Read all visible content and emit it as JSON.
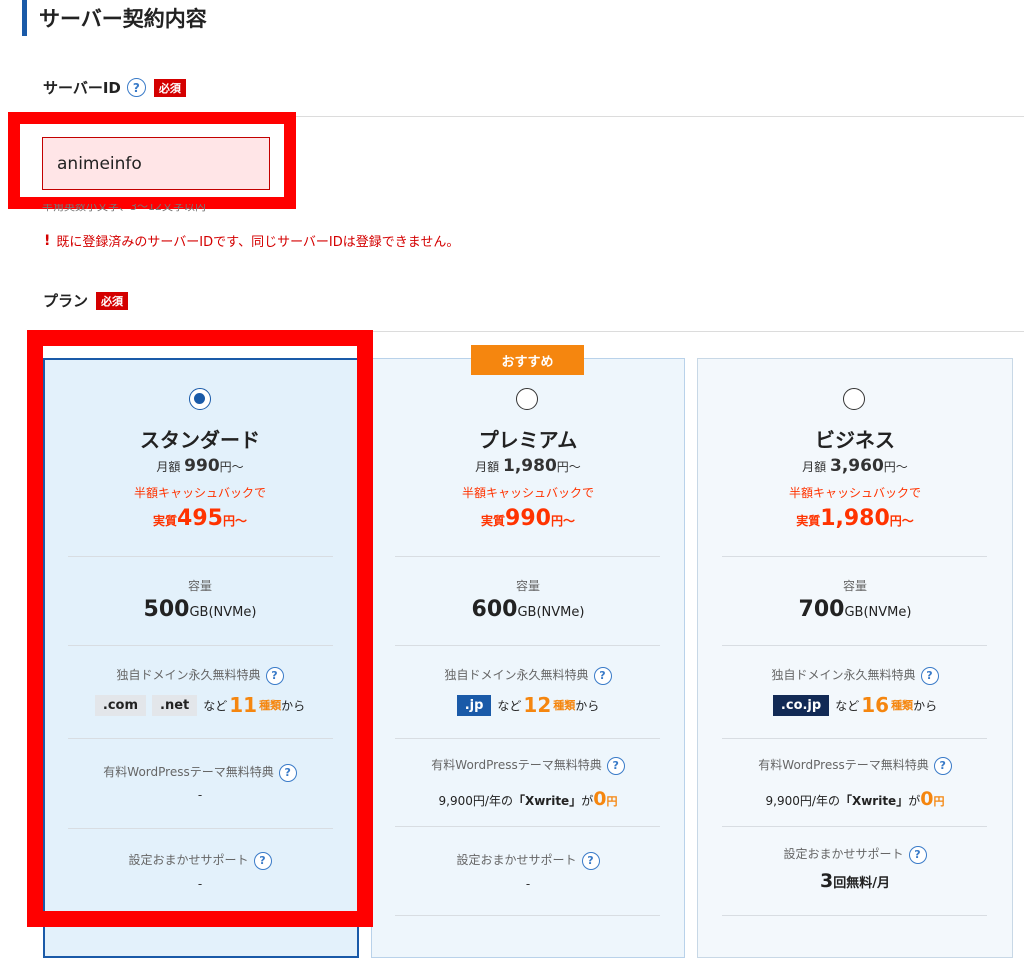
{
  "section_title": "サーバー契約内容",
  "server_id": {
    "label": "サーバーID",
    "required_badge": "必須",
    "value": "animeinfo",
    "hint": "半角英数小文字、3〜12文字以内",
    "error": "既に登録済みのサーバーIDです、同じサーバーIDは登録できません。",
    "error_icon": "!"
  },
  "plan": {
    "label": "プラン",
    "required_badge": "必須",
    "recommend_badge": "おすすめ",
    "cards": [
      {
        "name": "スタンダード",
        "monthly_prefix": "月額",
        "monthly_price": "990",
        "monthly_suffix": "円〜",
        "cashback": "半額キャッシュバックで",
        "effective_prefix": "実質",
        "effective_price": "495",
        "effective_suffix": "円〜",
        "capacity_label": "容量",
        "capacity_value": "500",
        "capacity_unit": "GB(NVMe)",
        "domain_label": "独自ドメイン永久無料特典",
        "tlds": [
          ".com",
          ".net"
        ],
        "domain_mid": "など",
        "domain_count": "11",
        "domain_unit": "種類",
        "domain_suffix": "から",
        "theme_label": "有料WordPressテーマ無料特典",
        "theme_value": "-",
        "support_label": "設定おまかせサポート",
        "support_value": "-",
        "selected": true
      },
      {
        "name": "プレミアム",
        "monthly_prefix": "月額",
        "monthly_price": "1,980",
        "monthly_suffix": "円〜",
        "cashback": "半額キャッシュバックで",
        "effective_prefix": "実質",
        "effective_price": "990",
        "effective_suffix": "円〜",
        "capacity_label": "容量",
        "capacity_value": "600",
        "capacity_unit": "GB(NVMe)",
        "domain_label": "独自ドメイン永久無料特典",
        "tlds": [
          ".jp"
        ],
        "domain_mid": "など",
        "domain_count": "12",
        "domain_unit": "種類",
        "domain_suffix": "から",
        "theme_label": "有料WordPressテーマ無料特典",
        "theme_prefix": "9,900円/年の",
        "theme_name": "「Xwrite」",
        "theme_mid": "が",
        "theme_zero": "0",
        "theme_zero_unit": "円",
        "support_label": "設定おまかせサポート",
        "support_value": "-",
        "selected": false
      },
      {
        "name": "ビジネス",
        "monthly_prefix": "月額",
        "monthly_price": "3,960",
        "monthly_suffix": "円〜",
        "cashback": "半額キャッシュバックで",
        "effective_prefix": "実質",
        "effective_price": "1,980",
        "effective_suffix": "円〜",
        "capacity_label": "容量",
        "capacity_value": "700",
        "capacity_unit": "GB(NVMe)",
        "domain_label": "独自ドメイン永久無料特典",
        "tlds": [
          ".co.jp"
        ],
        "domain_mid": "など",
        "domain_count": "16",
        "domain_unit": "種類",
        "domain_suffix": "から",
        "theme_label": "有料WordPressテーマ無料特典",
        "theme_prefix": "9,900円/年の",
        "theme_name": "「Xwrite」",
        "theme_mid": "が",
        "theme_zero": "0",
        "theme_zero_unit": "円",
        "support_label": "設定おまかせサポート",
        "support_count": "3",
        "support_unit": "回無料/月",
        "selected": false
      }
    ]
  },
  "help_icon_glyph": "?",
  "colors": {
    "accent": "#1a5aa8",
    "required": "#d40000",
    "highlight_frame": "#ff0000",
    "recommend": "#f5860f",
    "price_red": "#ff3300"
  }
}
